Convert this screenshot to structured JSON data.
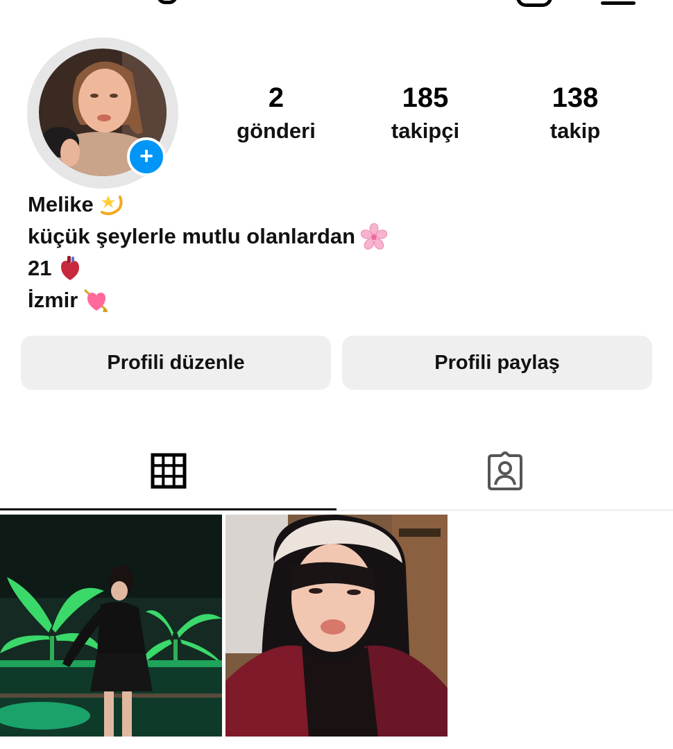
{
  "profile": {
    "name": "Melike",
    "name_emoji": "dizzy-star-emoji",
    "bio_lines": [
      {
        "text": "küçük şeylerle mutlu olanlardan",
        "emoji": "cherry-blossom-emoji"
      },
      {
        "text": "21",
        "emoji": "anatomical-heart-emoji"
      },
      {
        "text": "İzmir",
        "emoji": "heart-with-arrow-emoji"
      }
    ]
  },
  "stats": {
    "posts": {
      "value": "2",
      "label": "gönderi"
    },
    "followers": {
      "value": "185",
      "label": "takipçi"
    },
    "following": {
      "value": "138",
      "label": "takip"
    }
  },
  "buttons": {
    "edit_profile": "Profili düzenle",
    "share_profile": "Profili paylaş"
  },
  "tabs": [
    {
      "icon": "grid-icon",
      "active": true
    },
    {
      "icon": "tagged-person-icon",
      "active": false
    }
  ],
  "colors": {
    "accent_blue": "#0095f6",
    "button_bg": "#efefef",
    "avatar_ring": "#e6e6e6",
    "divider": "#dbdbdb"
  }
}
